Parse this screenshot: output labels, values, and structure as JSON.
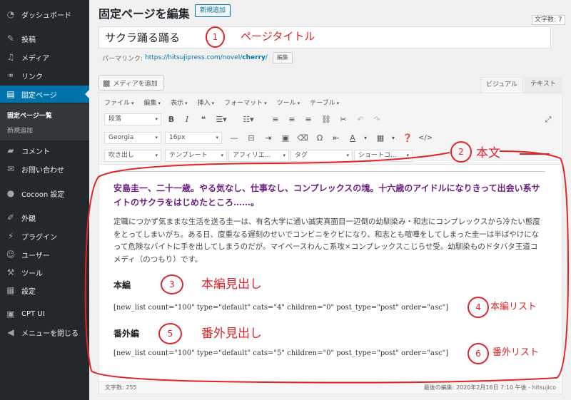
{
  "sidebar": {
    "items": [
      {
        "label": "ダッシュボード",
        "icon": "dashboard-icon",
        "glyph": "◔"
      },
      {
        "label": "投稿",
        "icon": "pin-icon",
        "glyph": "✎"
      },
      {
        "label": "メディア",
        "icon": "media-icon",
        "glyph": "♫"
      },
      {
        "label": "リンク",
        "icon": "link-icon",
        "glyph": "⚭"
      },
      {
        "label": "固定ページ",
        "icon": "pages-icon",
        "glyph": "▤"
      },
      {
        "label": "コメント",
        "icon": "comment-icon",
        "glyph": "▰"
      },
      {
        "label": "お問い合わせ",
        "icon": "mail-icon",
        "glyph": "✉"
      },
      {
        "label": "Cocoon 設定",
        "icon": "cocoon-icon",
        "glyph": "●"
      },
      {
        "label": "外観",
        "icon": "brush-icon",
        "glyph": "✐"
      },
      {
        "label": "プラグイン",
        "icon": "plugin-icon",
        "glyph": "⚡"
      },
      {
        "label": "ユーザー",
        "icon": "user-icon",
        "glyph": "☺"
      },
      {
        "label": "ツール",
        "icon": "wrench-icon",
        "glyph": "⚒"
      },
      {
        "label": "設定",
        "icon": "settings-icon",
        "glyph": "▦"
      },
      {
        "label": "CPT UI",
        "icon": "cptui-icon",
        "glyph": "▣"
      },
      {
        "label": "メニューを閉じる",
        "icon": "collapse-icon",
        "glyph": "◀"
      }
    ],
    "submenu": [
      "固定ページ一覧",
      "新規追加"
    ]
  },
  "header": {
    "title": "固定ページを編集",
    "add_new": "新規追加",
    "char_count": "文字数: 7"
  },
  "post_title": "サクラ踊る踊る",
  "permalink": {
    "label": "パーマリンク:",
    "url_base": "https://hitsujipress.com/novel/",
    "slug": "cherry",
    "url_end": "/",
    "edit": "編集"
  },
  "media_button": "メディアを追加",
  "tabs": {
    "visual": "ビジュアル",
    "text": "テキスト"
  },
  "menubar": [
    "ファイル",
    "編集",
    "表示",
    "挿入",
    "フォーマット",
    "ツール",
    "テーブル"
  ],
  "toolbar": {
    "format_select": "段落",
    "font_select": "Georgia",
    "size_select": "16px",
    "speech_select": "吹き出し",
    "template_select": "テンプレート",
    "affiliate_select": "アフィリエ...",
    "tag_select": "タグ",
    "shortcode_select": "ショートコ..."
  },
  "content": {
    "intro": "安島圭一、二十一歳。やる気なし、仕事なし、コンプレックスの塊。十六歳のアイドルになりきって出会い系サイトのサクラをはじめたところ……。",
    "body": "定職につかず気ままな生活を送る圭一は、有名大学に通い誠実真面目一辺倒の幼馴染み・和志にコンプレックスから冷たい態度をとってしまいがち。ある日、度重なる遅刻のせいでコンビニをクビになり、和志とも喧嘩をしてしまった圭一は半ばやけになって危険なバイトに手を出してしまうのだが。マイペースわんこ系攻×コンプレックスこじらせ受。幼馴染ものドタバタ王道コメディ（のつもり）です。",
    "heading_main": "本編",
    "shortcode_main": "[new_list count=\"100\" type=\"default\" cats=\"4\" children=\"0\" post_type=\"post\" order=\"asc\"]",
    "heading_extra": "番外編",
    "shortcode_extra": "[new_list count=\"100\" type=\"default\" cats=\"5\" children=\"0\" post_type=\"post\" order=\"asc\"]"
  },
  "status": {
    "word_count": "文字数: 255",
    "last_edit": "最後の編集: 2020年2月16日 7:10 午後 - hitsujico"
  },
  "annotations": {
    "n1": "1",
    "t1": "ページタイトル",
    "n2": "2",
    "t2": "本文",
    "n3": "3",
    "t3": "本編見出し",
    "n4": "4",
    "t4": "本編リスト",
    "n5": "5",
    "t5": "番外見出し",
    "n6": "6",
    "t6": "番外リスト"
  },
  "colors": {
    "annotation": "#e0242a",
    "sidebar_bg": "#23282d",
    "accent": "#0073aa",
    "intro_text": "#6c1f82"
  }
}
